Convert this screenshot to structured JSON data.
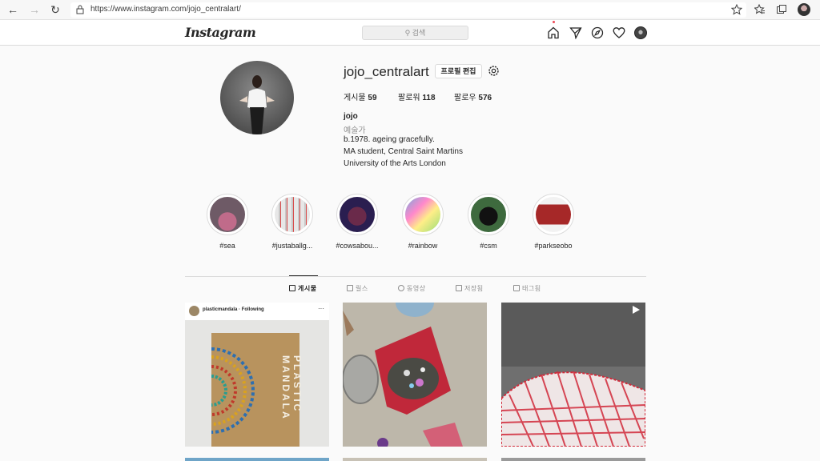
{
  "browser": {
    "url": "https://www.instagram.com/jojo_centralart/"
  },
  "header": {
    "logo": "Instagram",
    "search_placeholder": "검색"
  },
  "profile": {
    "username": "jojo_centralart",
    "edit_label": "프로필 편집",
    "stats": {
      "posts_label": "게시물",
      "posts_value": "59",
      "followers_label": "팔로워",
      "followers_value": "118",
      "following_label": "팔로우",
      "following_value": "576"
    },
    "name": "jojo",
    "category": "예술가",
    "bio": [
      "b.1978. ageing gracefully.",
      "MA student, Central Saint Martins",
      "University of the Arts London"
    ]
  },
  "highlights": [
    {
      "label": "#sea",
      "color": "#7e5a6e"
    },
    {
      "label": "#justaballg...",
      "color": "#d9d9d9"
    },
    {
      "label": "#cowsabou...",
      "color": "#3a2a5a"
    },
    {
      "label": "#rainbow",
      "color": "#d8b0c0"
    },
    {
      "label": "#csm",
      "color": "#2e4e2e"
    },
    {
      "label": "#parkseobo",
      "color": "#a62828"
    }
  ],
  "tabs": [
    {
      "label": "게시물"
    },
    {
      "label": "릴스"
    },
    {
      "label": "동영상"
    },
    {
      "label": "저장됨"
    },
    {
      "label": "태그됨"
    }
  ],
  "posts": {
    "post1_user": "plasticmandala",
    "post1_following": "Following",
    "post1_book_title": "PLASTIC MANDALA"
  },
  "colors": {
    "accent_red": "#ed4956",
    "border": "#dbdbdb",
    "muted_text": "#8e8e8e"
  }
}
